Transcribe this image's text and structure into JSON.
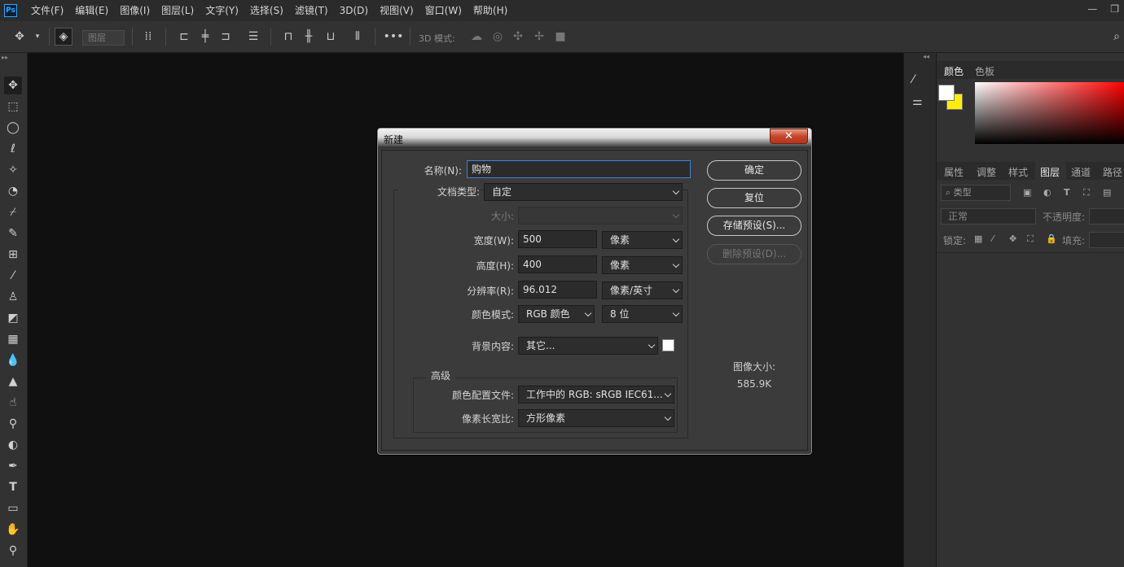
{
  "app": {
    "logo": "Ps"
  },
  "menu": [
    "文件(F)",
    "编辑(E)",
    "图像(I)",
    "图层(L)",
    "文字(Y)",
    "选择(S)",
    "滤镜(T)",
    "3D(D)",
    "视图(V)",
    "窗口(W)",
    "帮助(H)"
  ],
  "options": {
    "layer_select": "图层",
    "mode_3d_label": "3D 模式:"
  },
  "right_panels": {
    "top_tabs": [
      "颜色",
      "色板"
    ],
    "mid_tabs": [
      "属性",
      "调整",
      "样式",
      "图层",
      "通道",
      "路径"
    ],
    "layer_filter": "类型",
    "blend_mode": "正常",
    "opacity_label": "不透明度:",
    "lock_label": "锁定:",
    "fill_label": "填充:"
  },
  "dialog": {
    "title": "新建",
    "close_glyph": "✕",
    "fields": {
      "name_label": "名称(N):",
      "name_value": "购物",
      "doc_type_label": "文档类型:",
      "doc_type_value": "自定",
      "size_label": "大小:",
      "width_label": "宽度(W):",
      "width_value": "500",
      "width_unit": "像素",
      "height_label": "高度(H):",
      "height_value": "400",
      "height_unit": "像素",
      "resolution_label": "分辨率(R):",
      "resolution_value": "96.012",
      "resolution_unit": "像素/英寸",
      "color_mode_label": "颜色模式:",
      "color_mode_value": "RGB 颜色",
      "bit_depth": "8 位",
      "background_label": "背景内容:",
      "background_value": "其它...",
      "background_swatch": "#ffffff",
      "advanced_label": "高级",
      "profile_label": "颜色配置文件:",
      "profile_value": "工作中的 RGB: sRGB IEC61...",
      "pixel_aspect_label": "像素长宽比:",
      "pixel_aspect_value": "方形像素"
    },
    "buttons": {
      "ok": "确定",
      "reset": "复位",
      "save_preset": "存储预设(S)...",
      "delete_preset": "删除预设(D)..."
    },
    "image_size_label": "图像大小:",
    "image_size_value": "585.9K"
  },
  "colors": {
    "foreground": "#ffffff",
    "background": "#ffee00",
    "accent_focus": "#3b84d8"
  }
}
